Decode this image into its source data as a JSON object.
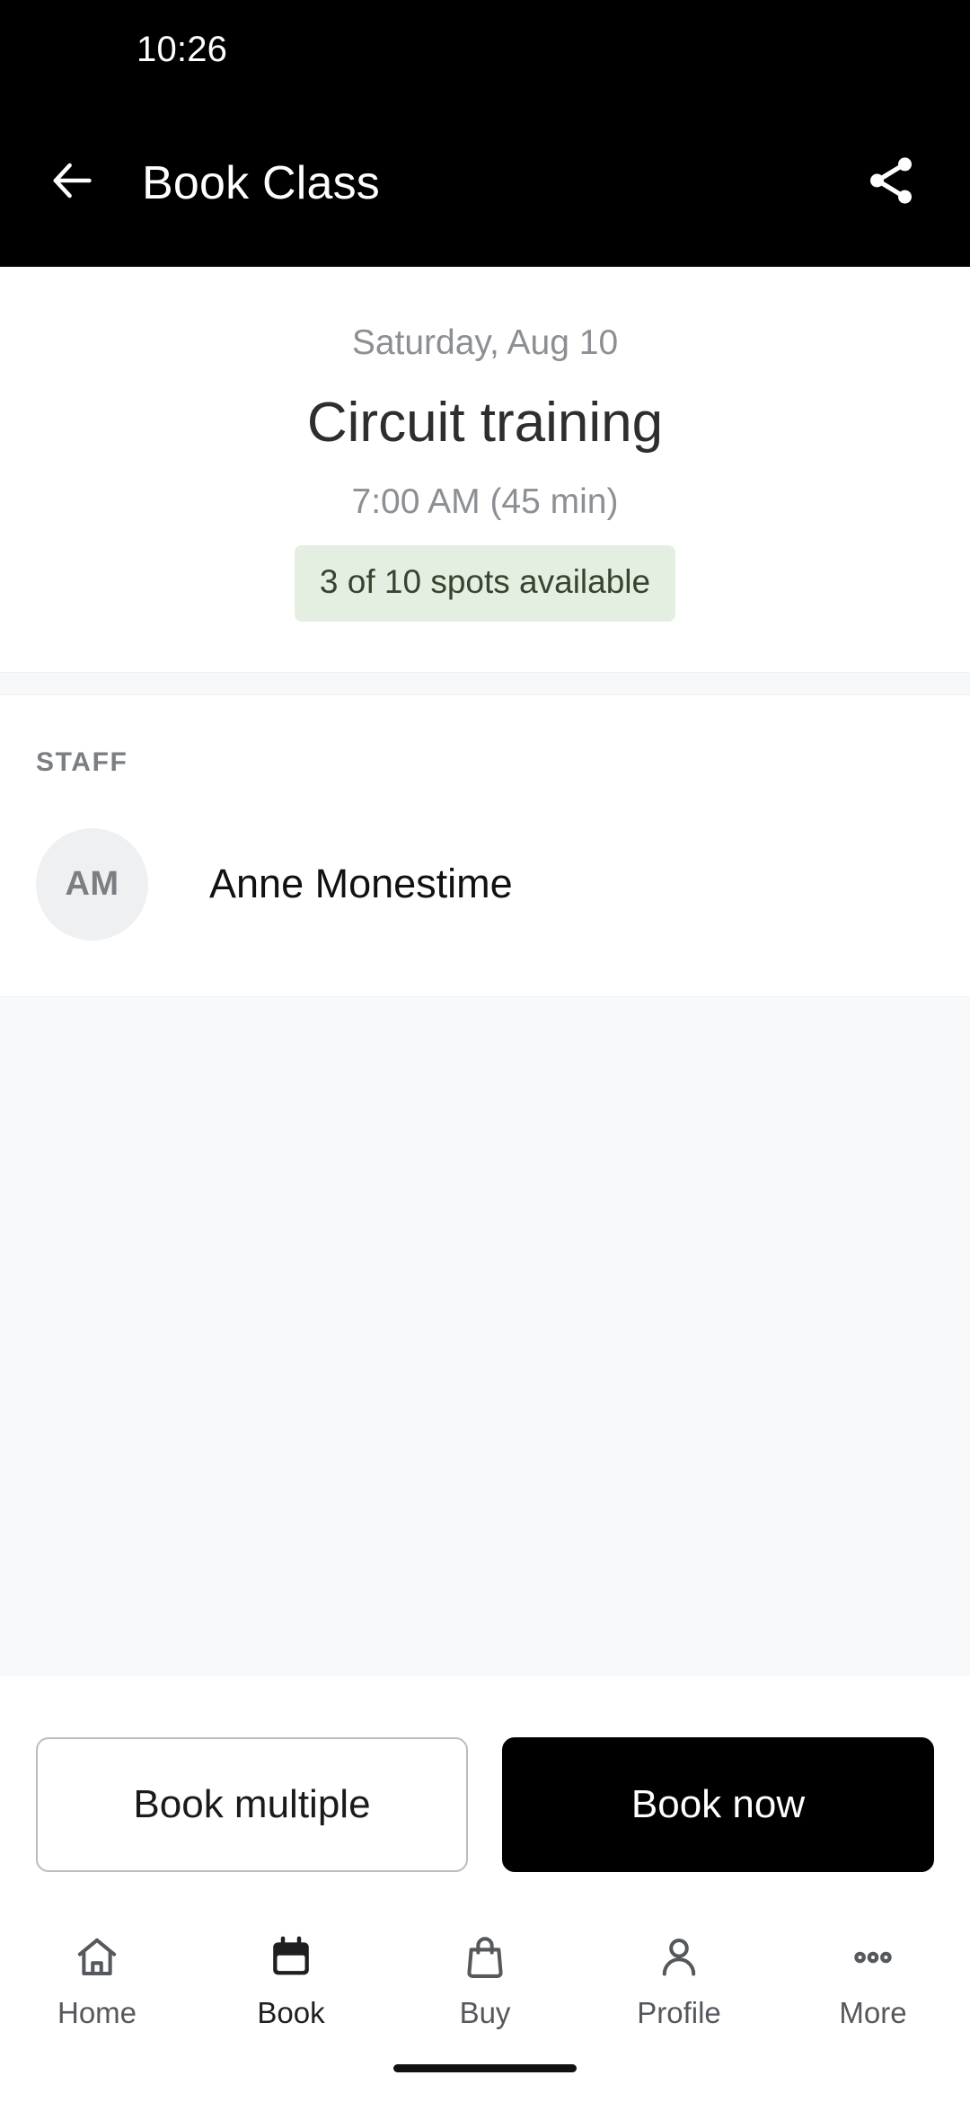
{
  "status_bar": {
    "time": "10:26"
  },
  "app_bar": {
    "title": "Book Class",
    "back_icon": "arrow-left-icon",
    "share_icon": "share-icon"
  },
  "hero": {
    "date": "Saturday, Aug 10",
    "class_name": "Circuit training",
    "time": "7:00 AM (45 min)",
    "spots": "3 of 10 spots available",
    "spots_bg_color": "#e4efe1",
    "spots_text_color": "#37442f"
  },
  "staff": {
    "section_label": "STAFF",
    "members": [
      {
        "initials": "AM",
        "name": "Anne Monestime"
      }
    ]
  },
  "footer": {
    "secondary_label": "Book multiple",
    "primary_label": "Book now",
    "primary_bg_color": "#000000"
  },
  "bottom_nav": {
    "items": [
      {
        "label": "Home",
        "icon": "home-icon",
        "active": false
      },
      {
        "label": "Book",
        "icon": "calendar-icon",
        "active": true
      },
      {
        "label": "Buy",
        "icon": "bag-icon",
        "active": false
      },
      {
        "label": "Profile",
        "icon": "person-icon",
        "active": false
      },
      {
        "label": "More",
        "icon": "dots-icon",
        "active": false
      }
    ]
  }
}
